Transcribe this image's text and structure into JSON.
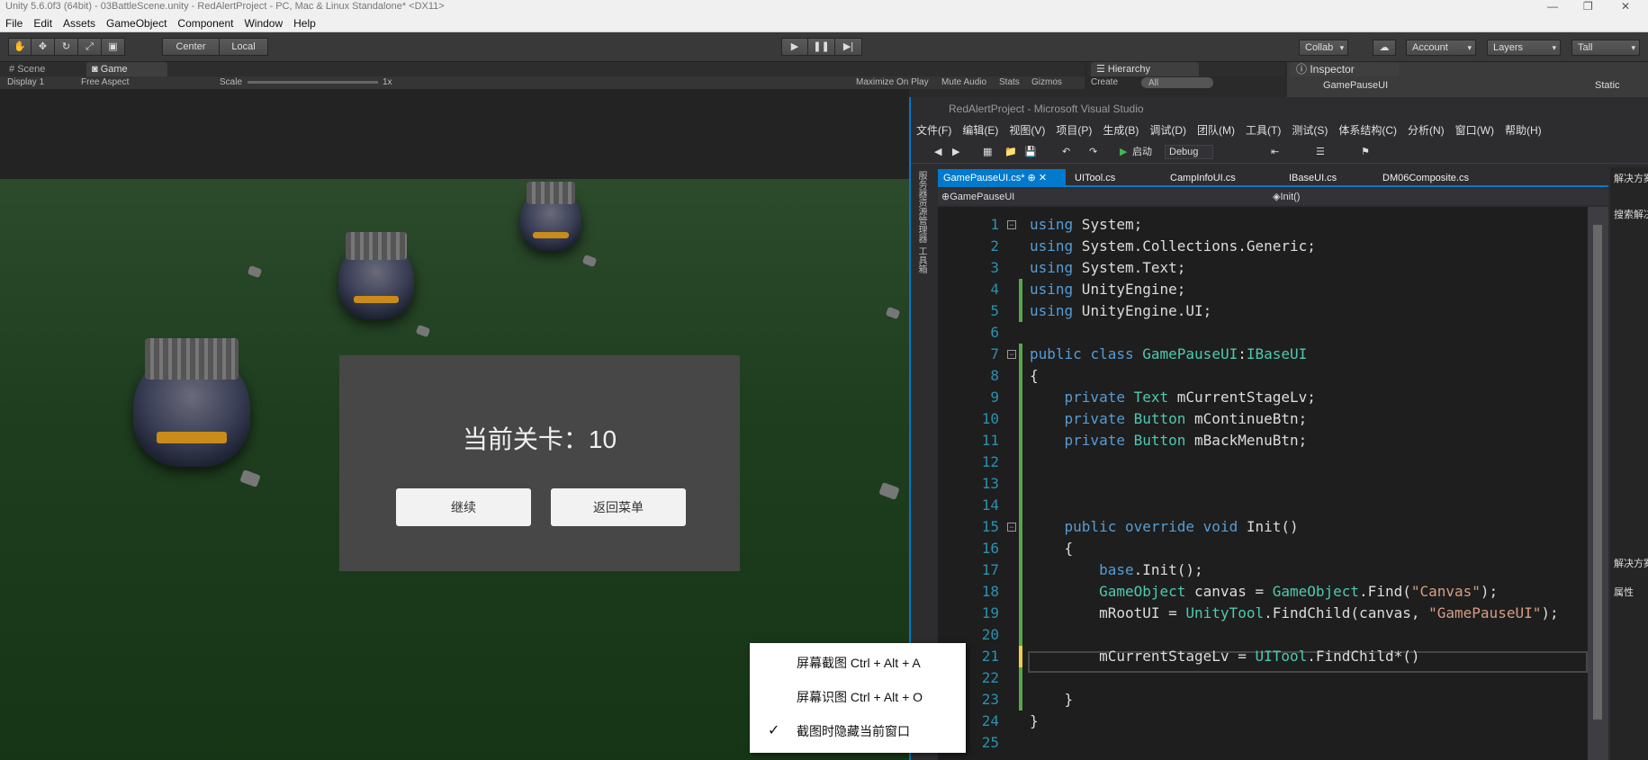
{
  "unity": {
    "title": "Unity 5.6.0f3 (64bit) - 03BattleScene.unity - RedAlertProject - PC, Mac & Linux Standalone* <DX11>",
    "menu": [
      "File",
      "Edit",
      "Assets",
      "GameObject",
      "Component",
      "Window",
      "Help"
    ],
    "toolbar": {
      "pivot_center": "Center",
      "pivot_local": "Local",
      "collab": "Collab",
      "account": "Account",
      "layers": "Layers",
      "layout": "Tall"
    },
    "tabs": {
      "scene": "Scene",
      "game": "Game",
      "hierarchy": "Hierarchy",
      "inspector": "Inspector"
    },
    "game_bar": {
      "display": "Display 1",
      "aspect": "Free Aspect",
      "scale_label": "Scale",
      "scale_value": "1x",
      "maximize": "Maximize On Play",
      "mute": "Mute Audio",
      "stats": "Stats",
      "gizmos": "Gizmos"
    },
    "hierarchy": {
      "create": "Create",
      "search_placeholder": "All"
    },
    "inspector": {
      "object_name": "GamePauseUI",
      "static_label": "Static"
    }
  },
  "game": {
    "stage_label": "当前关卡：10",
    "continue_button": "继续",
    "menu_button": "返回菜单"
  },
  "vs": {
    "title": "RedAlertProject - Microsoft Visual Studio",
    "menu": [
      "文件(F)",
      "编辑(E)",
      "视图(V)",
      "项目(P)",
      "生成(B)",
      "调试(D)",
      "团队(M)",
      "工具(T)",
      "测试(S)",
      "体系结构(C)",
      "分析(N)",
      "窗口(W)",
      "帮助(H)"
    ],
    "toolbar": {
      "start": "启动",
      "config": "Debug"
    },
    "doc_tabs": [
      "GamePauseUI.cs*",
      "UITool.cs",
      "CampInfoUI.cs",
      "IBaseUI.cs",
      "DM06Composite.cs"
    ],
    "nav": {
      "class": "GamePauseUI",
      "member": "Init()"
    },
    "right_panel": {
      "solution": "解决方案资",
      "search": "搜索解决方",
      "solution2": "解决方案资",
      "properties": "属性"
    },
    "side_labels": [
      "服务器资源管理器",
      "工具箱"
    ]
  },
  "code_lines": [
    "using System;",
    "using System.Collections.Generic;",
    "using System.Text;",
    "using UnityEngine;",
    "using UnityEngine.UI;",
    "",
    "public class GamePauseUI:IBaseUI",
    "{",
    "    private Text mCurrentStageLv;",
    "    private Button mContinueBtn;",
    "    private Button mBackMenuBtn;",
    "",
    "",
    "",
    "    public override void Init()",
    "    {",
    "        base.Init();",
    "        GameObject canvas = GameObject.Find(\"Canvas\");",
    "        mRootUI = UnityTool.FindChild(canvas, \"GamePauseUI\");",
    "",
    "        mCurrentStageLv = UITool.FindChild*()",
    "",
    "    }",
    "}",
    ""
  ],
  "context_menu": [
    {
      "label": "屏幕截图 Ctrl + Alt + A",
      "checked": false
    },
    {
      "label": "屏幕识图 Ctrl + Alt + O",
      "checked": false
    },
    {
      "label": "截图时隐藏当前窗口",
      "checked": true
    }
  ]
}
